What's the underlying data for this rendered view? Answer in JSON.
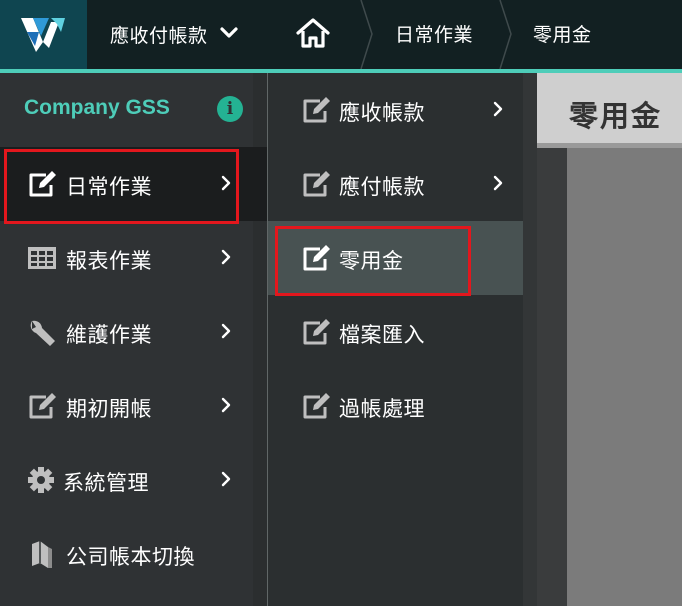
{
  "header": {
    "module_label": "應收付帳款",
    "breadcrumb": [
      "日常作業",
      "零用金"
    ]
  },
  "sidebar": {
    "company": "Company GSS",
    "items": [
      {
        "label": "日常作業",
        "icon": "edit-icon"
      },
      {
        "label": "報表作業",
        "icon": "table-icon"
      },
      {
        "label": "維護作業",
        "icon": "wrench-icon"
      },
      {
        "label": "期初開帳",
        "icon": "edit-icon"
      },
      {
        "label": "系統管理",
        "icon": "gear-icon"
      },
      {
        "label": "公司帳本切換",
        "icon": "book-icon"
      }
    ]
  },
  "submenu": {
    "items": [
      {
        "label": "應收帳款",
        "icon": "edit-icon"
      },
      {
        "label": "應付帳款",
        "icon": "edit-icon"
      },
      {
        "label": "零用金",
        "icon": "edit-icon"
      },
      {
        "label": "檔案匯入",
        "icon": "edit-icon"
      },
      {
        "label": "過帳處理",
        "icon": "edit-icon"
      }
    ]
  },
  "content": {
    "page_title": "零用金"
  },
  "colors": {
    "accent": "#4ecdb9",
    "info": "#24b293",
    "highlight_border": "#e3171d"
  }
}
